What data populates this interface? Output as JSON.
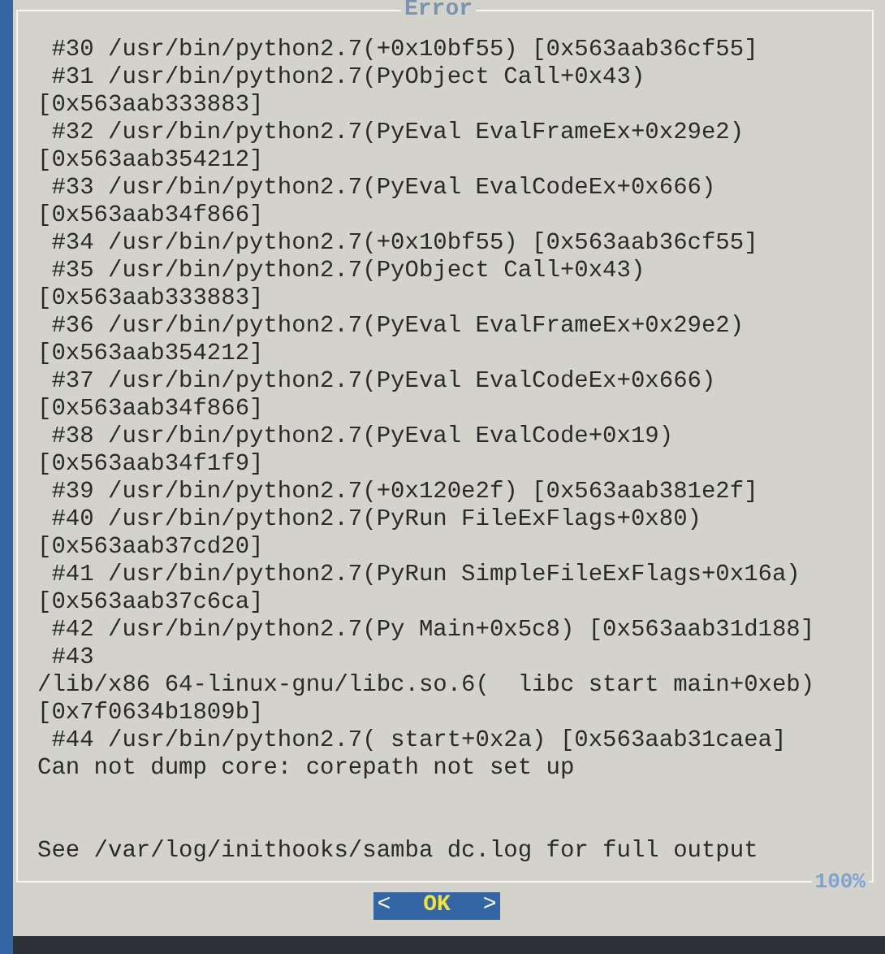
{
  "dialog": {
    "title": "Error",
    "lines": [
      " #30 /usr/bin/python2.7(+0x10bf55) [0x563aab36cf55]",
      " #31 /usr/bin/python2.7(PyObject Call+0x43)",
      "[0x563aab333883]",
      " #32 /usr/bin/python2.7(PyEval EvalFrameEx+0x29e2)",
      "[0x563aab354212]",
      " #33 /usr/bin/python2.7(PyEval EvalCodeEx+0x666)",
      "[0x563aab34f866]",
      " #34 /usr/bin/python2.7(+0x10bf55) [0x563aab36cf55]",
      " #35 /usr/bin/python2.7(PyObject Call+0x43)",
      "[0x563aab333883]",
      " #36 /usr/bin/python2.7(PyEval EvalFrameEx+0x29e2)",
      "[0x563aab354212]",
      " #37 /usr/bin/python2.7(PyEval EvalCodeEx+0x666)",
      "[0x563aab34f866]",
      " #38 /usr/bin/python2.7(PyEval EvalCode+0x19)",
      "[0x563aab34f1f9]",
      " #39 /usr/bin/python2.7(+0x120e2f) [0x563aab381e2f]",
      " #40 /usr/bin/python2.7(PyRun FileExFlags+0x80)",
      "[0x563aab37cd20]",
      " #41 /usr/bin/python2.7(PyRun SimpleFileExFlags+0x16a)",
      "[0x563aab37c6ca]",
      " #42 /usr/bin/python2.7(Py Main+0x5c8) [0x563aab31d188]",
      " #43",
      "/lib/x86 64-linux-gnu/libc.so.6(  libc start main+0xeb)",
      "[0x7f0634b1809b]",
      " #44 /usr/bin/python2.7( start+0x2a) [0x563aab31caea]",
      "Can not dump core: corepath not set up"
    ],
    "footer": "See /var/log/inithooks/samba dc.log for full output",
    "scroll_percent": "100%",
    "button": {
      "left": "<",
      "label": "OK",
      "right": ">",
      "selected": true
    }
  }
}
